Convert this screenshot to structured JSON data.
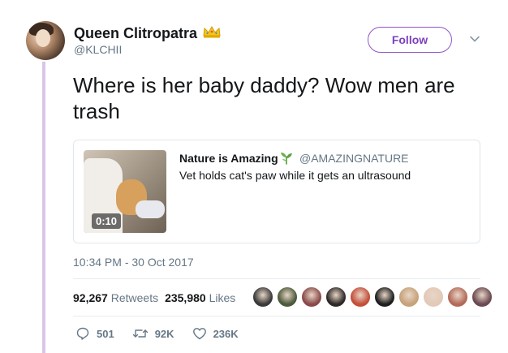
{
  "author": {
    "name": "Queen Clitropatra",
    "handle": "@KLCHII",
    "badge_icon": "crown-icon"
  },
  "follow_button": {
    "label": "Follow"
  },
  "tweet": {
    "text": "Where is her baby daddy? Wow men are trash",
    "timestamp": "10:34 PM - 30 Oct 2017"
  },
  "quoted_tweet": {
    "author_name": "Nature is Amazing",
    "author_icon": "sprout-icon",
    "author_handle": "@AMAZINGNATURE",
    "text": "Vet holds cat's paw while it gets an ultrasound",
    "video_duration": "0:10"
  },
  "stats": {
    "retweets_count": "92,267",
    "retweets_label": "Retweets",
    "likes_count": "235,980",
    "likes_label": "Likes"
  },
  "liker_avatars": [
    "#3a3a3a",
    "#4d5a3c",
    "#8a4b4b",
    "#2e2a28",
    "#c44f3a",
    "#1f1f1f",
    "#c7a27a",
    "#e2c9b8",
    "#b46a5a",
    "#6b4a52"
  ],
  "actions": {
    "reply_count": "501",
    "retweet_count": "92K",
    "like_count": "236K"
  },
  "colors": {
    "accent": "#9154c9",
    "thread_line": "#d9c6e9",
    "muted_text": "#657786"
  }
}
